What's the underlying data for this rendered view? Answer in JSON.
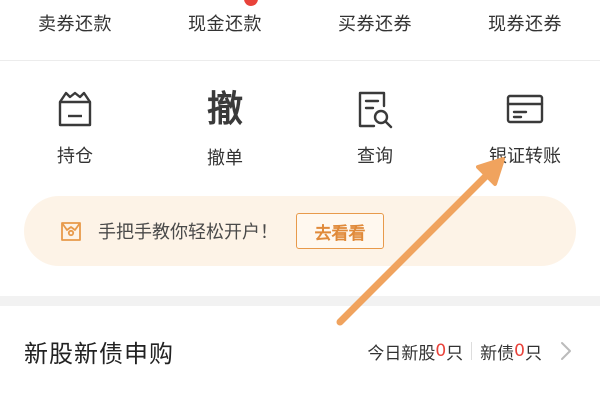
{
  "top_actions": [
    {
      "label": "卖券还款"
    },
    {
      "label": "现金还款"
    },
    {
      "label": "买券还券"
    },
    {
      "label": "现券还券"
    }
  ],
  "functions": [
    {
      "label": "持仓",
      "icon": "portfolio-icon"
    },
    {
      "label": "撤单",
      "icon": "cancel-order-icon",
      "glyph": "撤"
    },
    {
      "label": "查询",
      "icon": "query-icon"
    },
    {
      "label": "银证转账",
      "icon": "bank-transfer-icon"
    }
  ],
  "promo": {
    "text": "手把手教你轻松开户！",
    "button_label": "去看看",
    "icon": "gift-box-icon"
  },
  "ipo": {
    "title": "新股新债申购",
    "stock_prefix": "今日新股",
    "stock_count": "0",
    "stock_unit": "只",
    "bond_prefix": "新债",
    "bond_count": "0",
    "bond_unit": "只",
    "icon": "chevron-right-icon"
  },
  "colors": {
    "accent": "#e8423a",
    "promo_bg": "#fdf3e7",
    "promo_button": "#e08a3a",
    "annotation_arrow": "#f0a35e"
  }
}
